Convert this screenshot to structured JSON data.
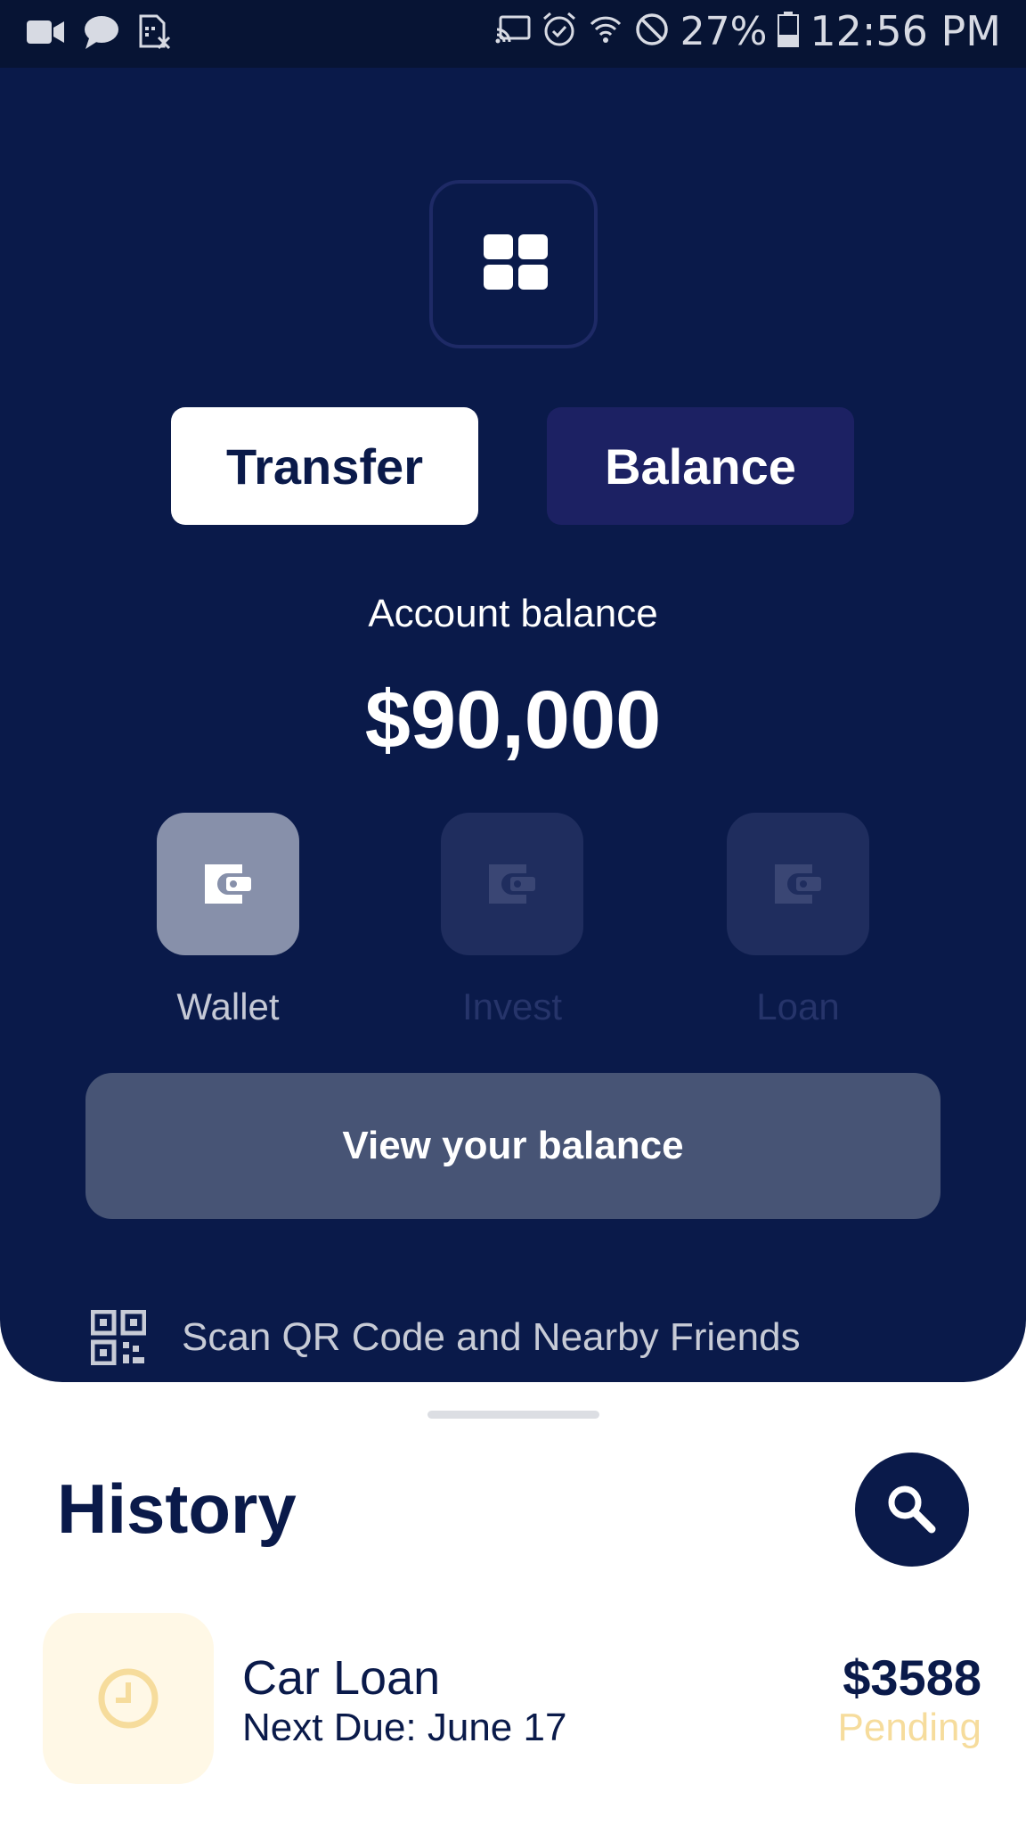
{
  "status_bar": {
    "battery": "27%",
    "time": "12:56 PM",
    "icons": [
      "video-icon",
      "chat-icon",
      "sim-icon",
      "cast-icon",
      "alarm-icon",
      "wifi-icon",
      "do-not-disturb-icon",
      "battery-icon"
    ]
  },
  "header": {
    "menu_icon": "grid-icon",
    "tabs": [
      {
        "label": "Transfer",
        "selected": true
      },
      {
        "label": "Balance",
        "selected": false
      }
    ],
    "account_label": "Account balance",
    "account_amount": "$90,000",
    "options": [
      {
        "label": "Wallet",
        "icon": "wallet-icon",
        "active": true
      },
      {
        "label": "Invest",
        "icon": "wallet-icon",
        "active": false
      },
      {
        "label": "Loan",
        "icon": "wallet-icon",
        "active": false
      }
    ],
    "view_button": "View your balance",
    "scan_text": "Scan QR Code and Nearby Friends",
    "scan_icon": "qr-code-icon"
  },
  "history": {
    "title": "History",
    "search_icon": "search-icon",
    "items": [
      {
        "title": "Car Loan",
        "subtitle": "Next Due: June 17",
        "amount": "$3588",
        "status": "Pending",
        "icon": "clock-icon"
      }
    ]
  },
  "colors": {
    "primary": "#0a1a4a",
    "pending": "#f6dc9c",
    "button_bg": "#475475"
  }
}
